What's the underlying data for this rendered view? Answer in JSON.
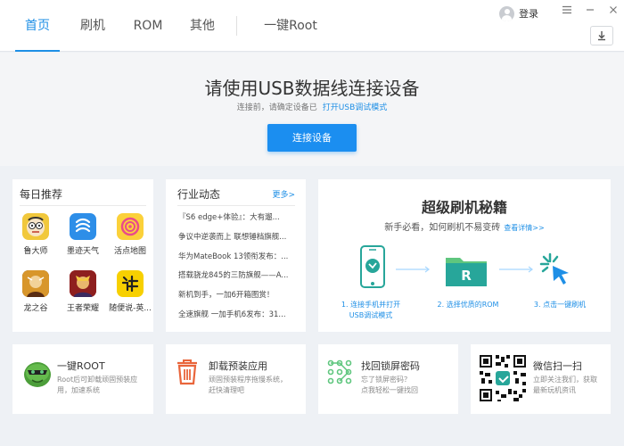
{
  "nav": {
    "tabs": [
      {
        "label": "首页",
        "active": true
      },
      {
        "label": "刷机",
        "active": false
      },
      {
        "label": "ROM",
        "active": false
      },
      {
        "label": "其他",
        "active": false
      },
      {
        "label": "一键Root",
        "active": false
      }
    ]
  },
  "window": {
    "login_label": "登录",
    "menu_icon": "hamburger-icon",
    "minimize_icon": "minimize-icon",
    "close_icon": "close-icon",
    "download_icon": "download-icon"
  },
  "hero": {
    "title": "请使用USB数据线连接设备",
    "subtitle": "连接前，请确定设备已",
    "subtitle_link": "打开USB调试模式",
    "button_label": "连接设备"
  },
  "daily": {
    "title": "每日推荐",
    "apps": [
      {
        "label": "鲁大师",
        "icon": "ludashi-icon"
      },
      {
        "label": "墨迹天气",
        "icon": "moji-weather-icon"
      },
      {
        "label": "活点地图",
        "icon": "huodian-map-icon"
      },
      {
        "label": "龙之谷",
        "icon": "dragon-nest-icon"
      },
      {
        "label": "王者荣耀",
        "icon": "honor-of-kings-icon"
      },
      {
        "label": "随便说-英...",
        "icon": "suibianshuo-icon"
      }
    ]
  },
  "news": {
    "title": "行业动态",
    "more": "更多>",
    "items": [
      "『S6 edge+体验』：大有遛...",
      "争议中逆袭而上 联想锤档旗舰...",
      "华为MateBook 13领衔发布：...",
      "搭载骁龙845的三防旗舰——A...",
      "新机到手，一加6开箱图赏！",
      "全速旗舰 一加手机6发布：31..."
    ]
  },
  "secret": {
    "title": "超级刷机秘籍",
    "subtitle": "新手必看，如何刷机不易变砖",
    "link": "查看详情>>",
    "steps": [
      "1. 连接手机并打开\nUSB调试模式",
      "2. 选择优质的ROM",
      "3. 点击一键刷机"
    ],
    "colors": {
      "accent": "#1e8fe6",
      "teal": "#27a69a",
      "green": "#5fc67e"
    }
  },
  "tools": [
    {
      "name": "一键ROOT",
      "desc": "Root后可卸载顽固预装应\n用，加速系统",
      "icon": "root-icon"
    },
    {
      "name": "卸载预装应用",
      "desc": "顽固预装程序拖慢系统，\n赶快清理吧",
      "icon": "trash-icon"
    },
    {
      "name": "找回锁屏密码",
      "desc": "忘了锁屏密码？\n点我轻松一键找回",
      "icon": "pattern-lock-icon"
    },
    {
      "name": "微信扫一扫",
      "desc": "立即关注我们，获取\n最新玩机资讯",
      "icon": "qr-code-icon"
    }
  ]
}
